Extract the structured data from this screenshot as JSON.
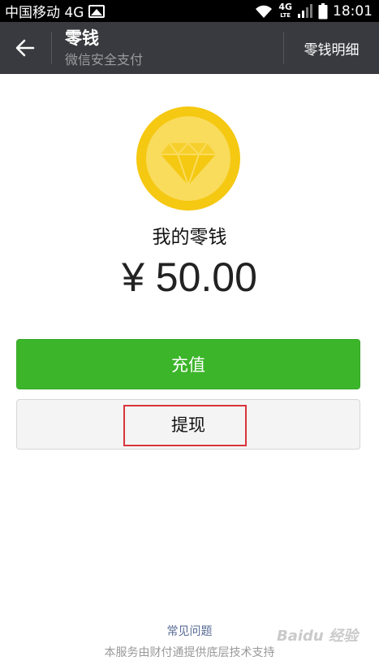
{
  "status_bar": {
    "carrier": "中国移动 4G",
    "network_badge": "4G",
    "network_badge_sub": "LTE",
    "time": "18:01"
  },
  "header": {
    "title": "零钱",
    "subtitle": "微信安全支付",
    "details_link": "零钱明细"
  },
  "wallet": {
    "label": "我的零钱",
    "balance": "¥ 50.00",
    "coin_color": "#f5c812",
    "coin_inner_color": "#f9dc5c"
  },
  "actions": {
    "recharge_label": "充值",
    "withdraw_label": "提现",
    "recharge_color": "#3cb52a"
  },
  "footer": {
    "faq_link": "常见问题",
    "note": "本服务由财付通提供底层技术支持"
  },
  "watermark": {
    "text": "Baidu 经验"
  }
}
